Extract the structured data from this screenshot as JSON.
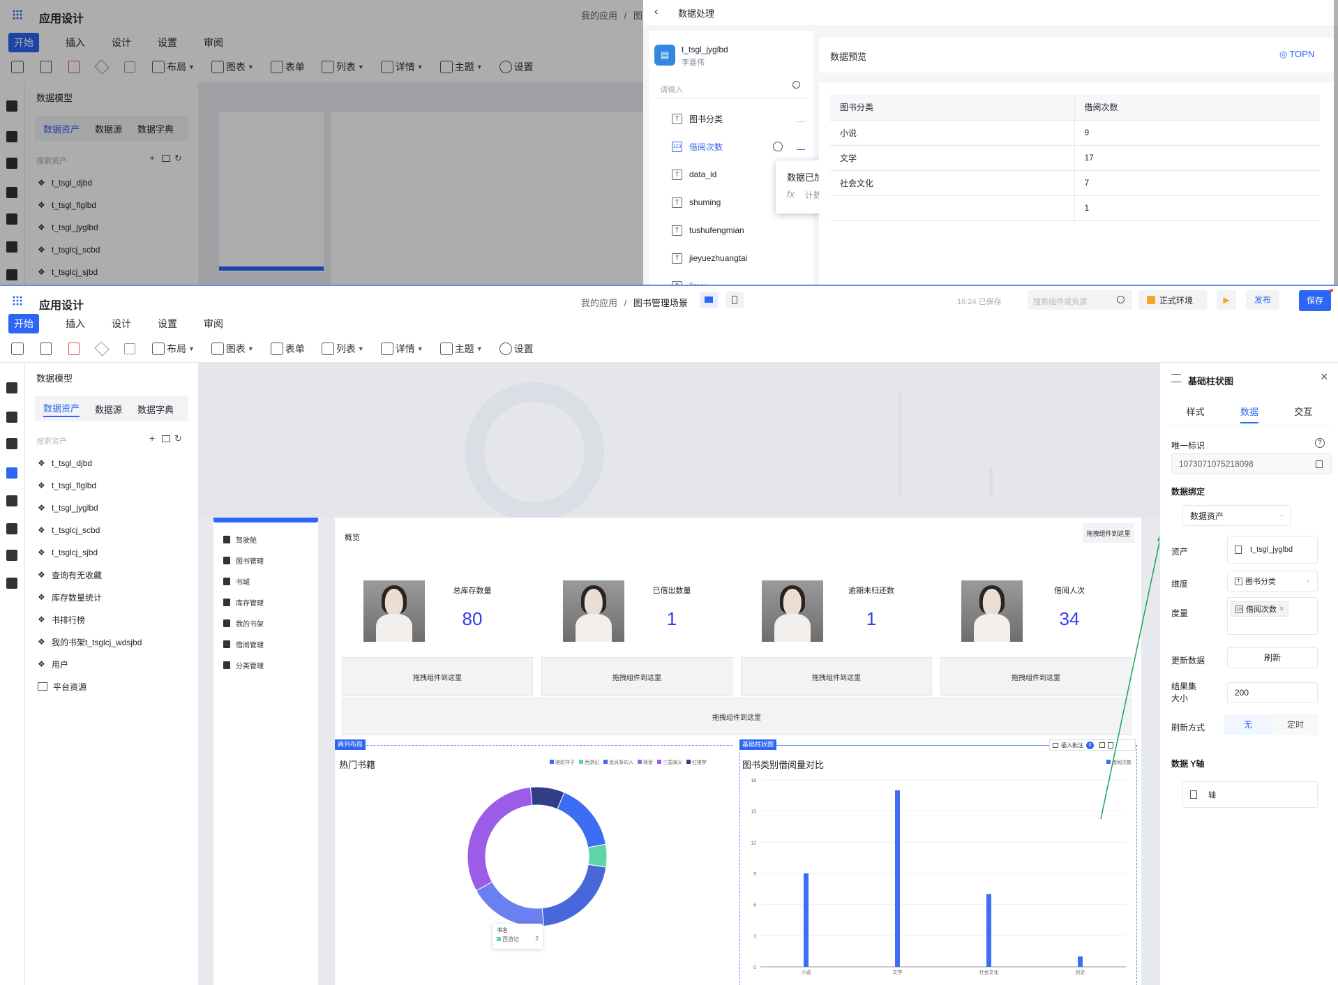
{
  "top_editor": {
    "app_title": "应用设计",
    "breadcrumb_start": "我的应用",
    "breadcrumb_sep": "/",
    "breadcrumb_partial": "图",
    "menu_tabs": [
      "开始",
      "插入",
      "设计",
      "设置",
      "审阅"
    ],
    "toolbar": [
      "布局",
      "图表",
      "表单",
      "列表",
      "详情",
      "主题",
      "设置"
    ],
    "model_title": "数据模型",
    "model_tabs": [
      "数据资产",
      "数据源",
      "数据字典"
    ],
    "search_placeholder": "搜索资产",
    "assets": [
      "t_tsgl_djbd",
      "t_tsgl_flglbd",
      "t_tsgl_jyglbd",
      "t_tsglcj_scbd",
      "t_tsglcj_sjbd"
    ]
  },
  "proc": {
    "title": "数据处理",
    "table_name": "t_tsgl_jyglbd",
    "owner": "李嘉伟",
    "search_placeholder": "请输入",
    "fields": [
      {
        "type": "T",
        "name": "图书分类"
      },
      {
        "type": "123",
        "name": "借阅次数"
      },
      {
        "type": "T",
        "name": "data_id"
      },
      {
        "type": "T",
        "name": "shuming"
      },
      {
        "type": "T",
        "name": "tushufengmian"
      },
      {
        "type": "T",
        "name": "jieyuezhuangtai"
      },
      {
        "type": "T",
        "name": "jieyu"
      }
    ],
    "tooltip_title": "数据已加工",
    "tooltip_fx": "fx",
    "tooltip_sub": "计数",
    "preview_title": "数据预览",
    "topn": "TOPN",
    "columns": [
      "图书分类",
      "借阅次数"
    ],
    "rows": [
      [
        "小说",
        "9"
      ],
      [
        "文学",
        "17"
      ],
      [
        "社会文化",
        "7"
      ],
      [
        "",
        "1"
      ]
    ]
  },
  "main": {
    "app_title": "应用设计",
    "breadcrumb_start": "我的应用",
    "breadcrumb_sep": "/",
    "breadcrumb_current": "图书管理场景",
    "saved": "16:24 已保存",
    "search_placeholder": "搜索组件或资源",
    "env": "正式环境",
    "publish": "发布",
    "save": "保存",
    "menu_tabs": [
      "开始",
      "插入",
      "设计",
      "设置",
      "审阅"
    ],
    "toolbar": [
      "布局",
      "图表",
      "表单",
      "列表",
      "详情",
      "主题",
      "设置"
    ],
    "model_title": "数据模型",
    "model_tabs": [
      "数据资产",
      "数据源",
      "数据字典"
    ],
    "search_assets": "搜索资产",
    "assets": [
      "t_tsgl_djbd",
      "t_tsgl_flglbd",
      "t_tsgl_jyglbd",
      "t_tsglcj_scbd",
      "t_tsglcj_sjbd",
      "查询有无收藏",
      "库存数量统计",
      "书排行榜",
      "我的书架t_tsglcj_wdsjbd",
      "用户",
      "平台资源"
    ],
    "nav_items": [
      "驾驶舱",
      "图书管理",
      "书城",
      "库存管理",
      "我的书架",
      "借阅管理",
      "分类管理"
    ],
    "overview_label": "概览",
    "drop_text": "拖拽组件到这里",
    "kpis": [
      {
        "label": "总库存数量",
        "value": "80"
      },
      {
        "label": "已借出数量",
        "value": "1"
      },
      {
        "label": "逾期未归还数",
        "value": "1"
      },
      {
        "label": "借阅人次",
        "value": "34"
      }
    ],
    "tag_left": "两列布局",
    "tag_right": "基础柱状图",
    "float_bar": {
      "insert": "插入批注",
      "count": "0"
    },
    "hot_title": "热门书籍",
    "hot_legend": [
      "骆驼祥子",
      "西游记",
      "追风筝的人",
      "简爱",
      "三国演义",
      "红楼梦"
    ],
    "hot_tooltip": {
      "title": "书名",
      "name": "西游记",
      "value": "2"
    },
    "bar_title": "图书类别借阅量对比",
    "bar_legend": "借阅次数"
  },
  "props": {
    "title": "基础柱状图",
    "tabs": [
      "样式",
      "数据",
      "交互"
    ],
    "id_label": "唯一标识",
    "id_value": "1073071075218098",
    "binding_label": "数据绑定",
    "binding_value": "数据资产",
    "asset_label": "资产",
    "asset_value": "t_tsgl_jyglbd",
    "dim_label": "维度",
    "dim_value": "图书分类",
    "measure_label": "度量",
    "measure_value": "借阅次数",
    "update_label": "更新数据",
    "refresh": "刷新",
    "result_label": "结果集大小",
    "result_value": "200",
    "refresh_mode_label": "刷新方式",
    "refresh_modes": [
      "无",
      "定时"
    ],
    "y_axis_label": "数据 Y轴",
    "axis_item": "轴"
  },
  "colors": {
    "primary": "#2d66f5",
    "kpi": "#2d3ee8",
    "bar": "#3d6df2"
  },
  "chart_data": [
    {
      "type": "bar",
      "title": "图书类别借阅量对比",
      "categories": [
        "小说",
        "文学",
        "社会文化",
        "历史"
      ],
      "series": [
        {
          "name": "借阅次数",
          "values": [
            9,
            17,
            7,
            1
          ]
        }
      ],
      "ylim": [
        0,
        18
      ],
      "yticks": [
        0,
        3,
        6,
        9,
        12,
        15,
        18
      ],
      "legend": "top-right"
    },
    {
      "type": "pie",
      "title": "热门书籍",
      "categories": [
        "骆驼祥子",
        "西游记",
        "追风筝的人",
        "简爱",
        "三国演义",
        "红楼梦"
      ],
      "values": [
        6,
        2,
        8,
        7,
        12,
        3
      ],
      "legend": "top-right"
    }
  ]
}
